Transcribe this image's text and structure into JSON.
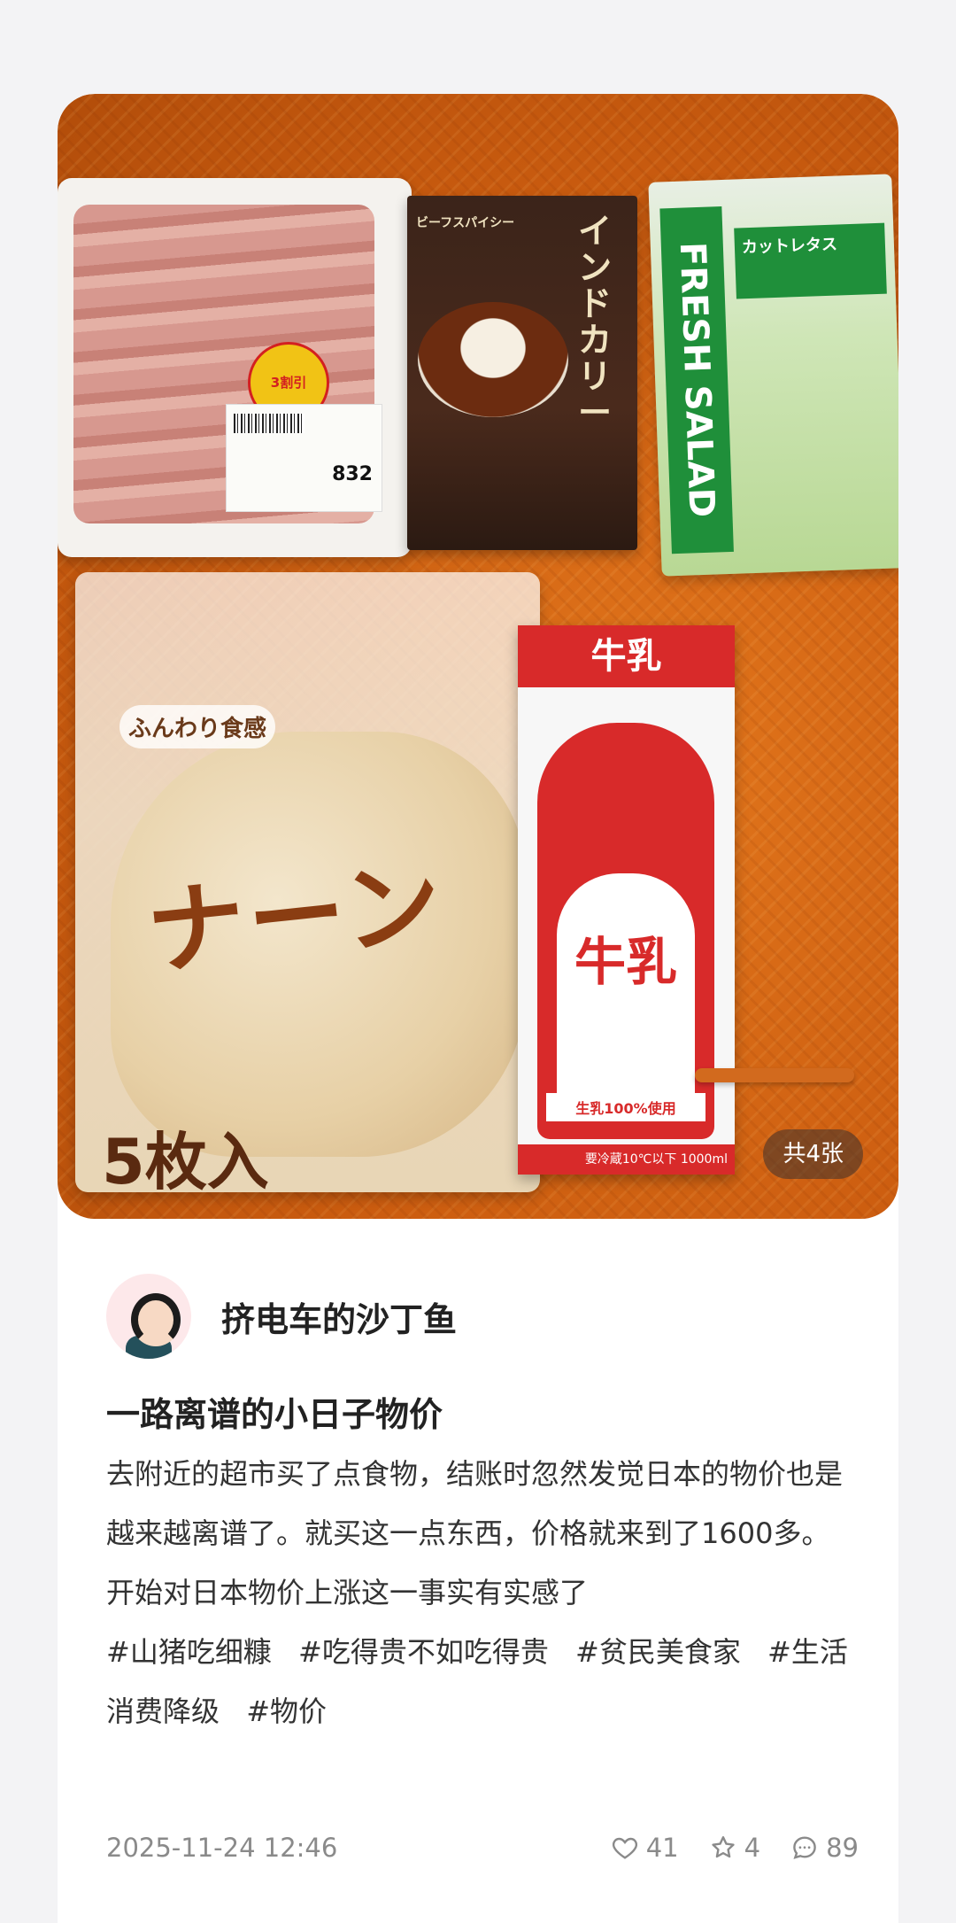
{
  "photo": {
    "image_count_label": "共4张",
    "products": {
      "meat_price": "832",
      "meat_sticker": "3割引",
      "curry_title": "インドカリー",
      "curry_subtitle": "ビーフスパイシー",
      "lettuce_band": "FRESH SALAD",
      "lettuce_label": "カットレタス",
      "naan_title": "ナーン",
      "naan_tagline": "ふんわり食感",
      "naan_count": "5枚入",
      "milk_header": "牛乳",
      "milk_main": "牛乳",
      "milk_tag": "生乳100%使用",
      "milk_volume": "要冷蔵10℃以下 1000ml"
    }
  },
  "post": {
    "author": "挤电车的沙丁鱼",
    "title": "一路离谱的小日子物价",
    "body_lines": [
      "去附近的超市买了点食物，结账时忽然发觉日本的物价也是越来越离谱了。就买这一点东西，价格就来到了1600多。",
      "开始对日本物价上涨这一事实有实感了"
    ],
    "tags": [
      "#山猪吃细糠",
      "#吃得贵不如吃得贵",
      "#贫民美食家",
      "#生活消费降级",
      "#物价"
    ],
    "date": "2025-11-24 12:46",
    "likes": "41",
    "favorites": "4",
    "comments": "89"
  },
  "colors": {
    "background": "#f3f3f5",
    "card": "#ffffff",
    "text_primary": "#222222",
    "text_meta": "#8a8a8a"
  },
  "icons": [
    "heart-icon",
    "star-icon",
    "comment-icon"
  ]
}
